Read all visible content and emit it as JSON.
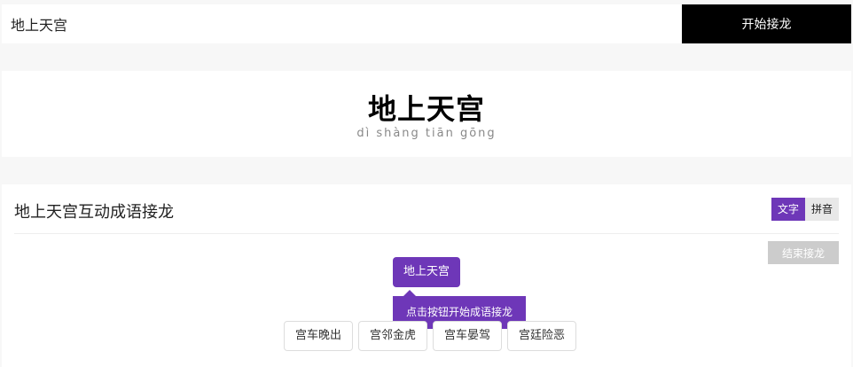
{
  "search": {
    "value": "地上天宫",
    "button_label": "开始接龙"
  },
  "word": {
    "title": "地上天宫",
    "pinyin": "dì shàng tiān gōng"
  },
  "game": {
    "title": "地上天宫互动成语接龙",
    "mode_text": "文字",
    "mode_pinyin": "拼音",
    "end_label": "结束接龙",
    "current_word": "地上天宫",
    "hint": "点击按钮开始成语接龙",
    "options": [
      {
        "label": "宫车晚出"
      },
      {
        "label": "宫邻金虎"
      },
      {
        "label": "宫车晏驾"
      },
      {
        "label": "宫廷险恶"
      }
    ]
  },
  "colors": {
    "accent": "#6e37b8",
    "search_button": "#000000",
    "end_button": "#cccccc"
  }
}
